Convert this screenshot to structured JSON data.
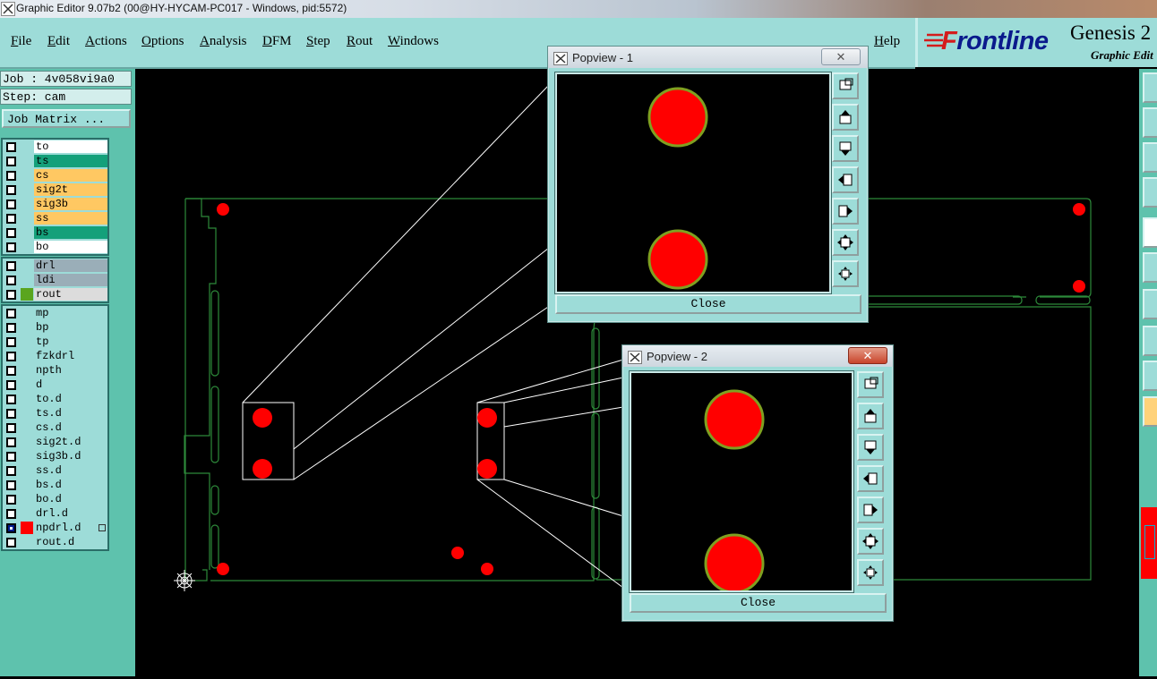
{
  "window": {
    "title": "Graphic Editor 9.07b2 (00@HY-HYCAM-PC017 - Windows, pid:5572)"
  },
  "menu": [
    "File",
    "Edit",
    "Actions",
    "Options",
    "Analysis",
    "DFM",
    "Step",
    "Rout",
    "Windows"
  ],
  "help_label": "Help",
  "brand": {
    "logo_prefix": "F",
    "logo_rest": "rontline",
    "product": "Genesis 2",
    "subtitle": "Graphic Edit"
  },
  "job": {
    "job_line": "Job : 4v058vi9a0",
    "step_line": "Step: cam",
    "matrix_button": "Job Matrix ..."
  },
  "colors": {
    "yellow": "#ffc862",
    "green": "#14a07a",
    "white": "#ffffff",
    "grey": "#9aaeb8",
    "rout": "#dcdcdc",
    "cyan": "#9ddcd8",
    "pad": "#ff0000",
    "pad_ring": "#7fa020",
    "outline": "#2d8a3a"
  },
  "layer_groups": [
    {
      "layers": [
        {
          "name": "to",
          "color": "white",
          "checked": false
        },
        {
          "name": "ts",
          "color": "green",
          "checked": false
        },
        {
          "name": "cs",
          "color": "yellow",
          "checked": false
        },
        {
          "name": "sig2t",
          "color": "yellow",
          "checked": false
        },
        {
          "name": "sig3b",
          "color": "yellow",
          "checked": false
        },
        {
          "name": "ss",
          "color": "yellow",
          "checked": false
        },
        {
          "name": "bs",
          "color": "green",
          "checked": false
        },
        {
          "name": "bo",
          "color": "white",
          "checked": false
        }
      ]
    },
    {
      "layers": [
        {
          "name": "drl",
          "color": "grey",
          "checked": false
        },
        {
          "name": "ldi",
          "color": "grey",
          "checked": false
        },
        {
          "name": "rout",
          "color": "rout",
          "checked": false,
          "swatch": "#5aa51e"
        }
      ]
    },
    {
      "layers": [
        {
          "name": "mp",
          "color": "cyan",
          "checked": false
        },
        {
          "name": "bp",
          "color": "cyan",
          "checked": false
        },
        {
          "name": "tp",
          "color": "cyan",
          "checked": false
        },
        {
          "name": "fzkdrl",
          "color": "cyan",
          "checked": false
        },
        {
          "name": "npth",
          "color": "cyan",
          "checked": false
        },
        {
          "name": "d",
          "color": "cyan",
          "checked": false
        },
        {
          "name": "to.d",
          "color": "cyan",
          "checked": false
        },
        {
          "name": "ts.d",
          "color": "cyan",
          "checked": false
        },
        {
          "name": "cs.d",
          "color": "cyan",
          "checked": false
        },
        {
          "name": "sig2t.d",
          "color": "cyan",
          "checked": false
        },
        {
          "name": "sig3b.d",
          "color": "cyan",
          "checked": false
        },
        {
          "name": "ss.d",
          "color": "cyan",
          "checked": false
        },
        {
          "name": "bs.d",
          "color": "cyan",
          "checked": false
        },
        {
          "name": "bo.d",
          "color": "cyan",
          "checked": false
        },
        {
          "name": "drl.d",
          "color": "cyan",
          "checked": false
        },
        {
          "name": "npdrl.d",
          "color": "cyan",
          "checked": true,
          "swatch": "#ff0000",
          "marker": true
        },
        {
          "name": "rout.d",
          "color": "cyan",
          "checked": false
        }
      ]
    }
  ],
  "popviews": [
    {
      "title": "Popview - 1",
      "close_label": "Close",
      "title_close": "✕",
      "close_style": "grey"
    },
    {
      "title": "Popview - 2",
      "close_label": "Close",
      "title_close": "✕",
      "close_style": "red"
    }
  ],
  "popview_tools": [
    "zoom-home-icon",
    "pan-up-icon",
    "pan-down-icon",
    "pan-left-icon",
    "pan-right-icon",
    "zoom-fit-icon",
    "zoom-center-icon"
  ]
}
